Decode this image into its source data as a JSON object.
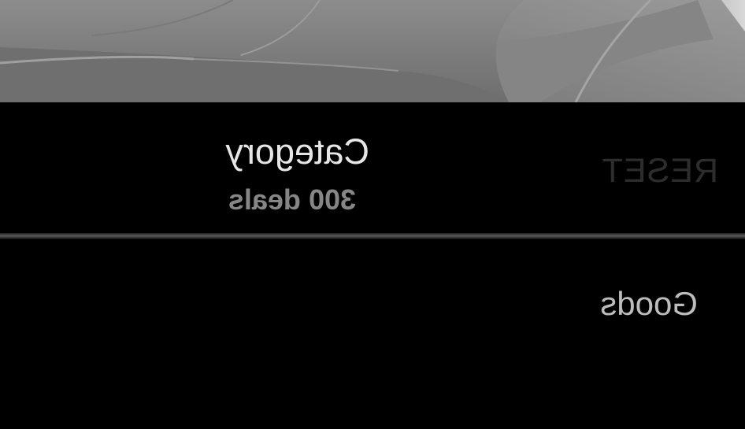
{
  "header": {
    "reset_label": "RESET",
    "title": "Category",
    "subtitle": "300 deals"
  },
  "hero": {
    "image": "grey bedding pillows"
  },
  "categories": [
    {
      "label": "Goods"
    }
  ],
  "colors": {
    "background": "#000000",
    "title_text": "#e6e6e6",
    "subtitle_text": "#868686",
    "reset_text": "#2d2d2d",
    "item_text": "#bdbdbd"
  }
}
